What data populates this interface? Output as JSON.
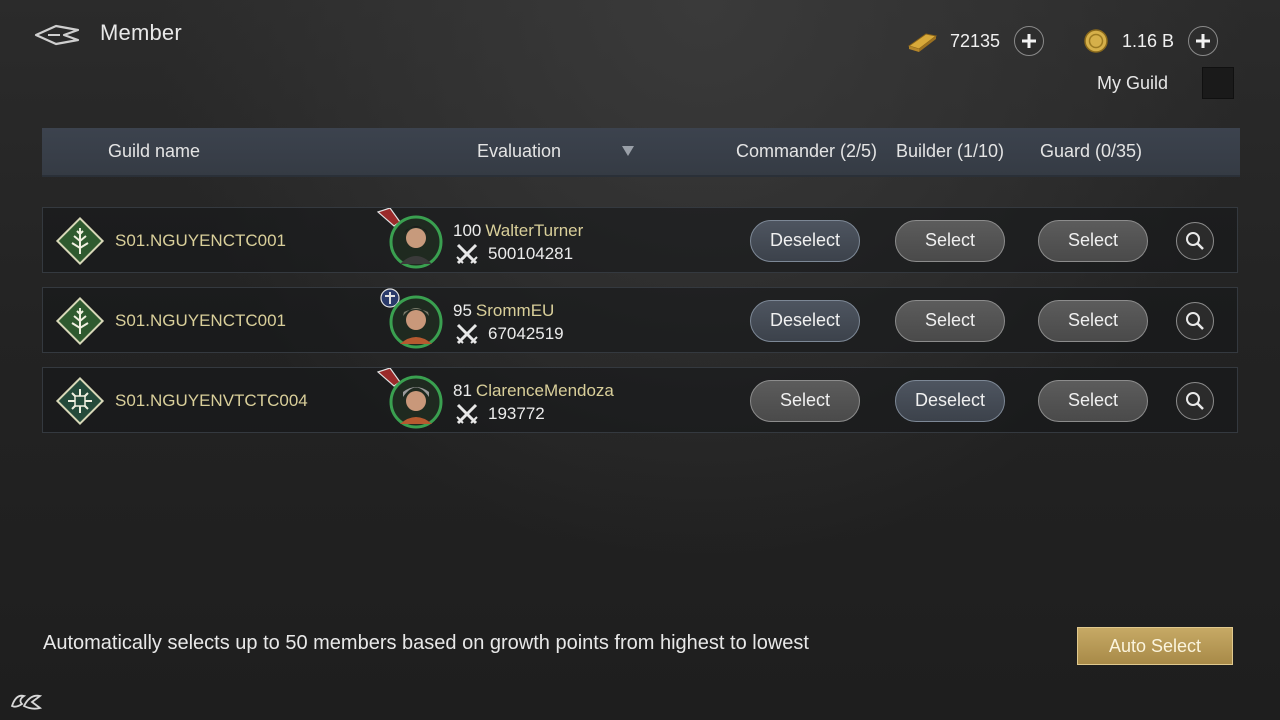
{
  "header": {
    "title": "Member",
    "back_icon": "back-arrow-icon",
    "gold_bar": {
      "icon": "gold-bar-icon",
      "value": "72135"
    },
    "coin": {
      "icon": "gold-coin-icon",
      "value": "1.16 B"
    },
    "my_guild_label": "My Guild"
  },
  "table": {
    "columns": {
      "guild_name": "Guild name",
      "evaluation": "Evaluation",
      "commander": "Commander (2/5)",
      "builder": "Builder (1/10)",
      "guard": "Guard (0/35)"
    },
    "rows": [
      {
        "guild": "S01.NGUYENCTC001",
        "level": "100",
        "name": "WalterTurner",
        "power": "500104281",
        "commander": "Deselect",
        "builder": "Select",
        "guard": "Select"
      },
      {
        "guild": "S01.NGUYENCTC001",
        "level": "95",
        "name": "SrommEU",
        "power": "67042519",
        "commander": "Deselect",
        "builder": "Select",
        "guard": "Select"
      },
      {
        "guild": "S01.NGUYENVTCTC004",
        "level": "81",
        "name": "ClarenceMendoza",
        "power": "193772",
        "commander": "Select",
        "builder": "Deselect",
        "guard": "Select"
      }
    ]
  },
  "footer": {
    "note": "Automatically selects up to 50 members based on growth points from highest to lowest",
    "auto_select": "Auto Select"
  },
  "colors": {
    "gold_text": "#d9cf9a",
    "header_bar": "#3c434e",
    "auto_button": "#c6a965"
  }
}
